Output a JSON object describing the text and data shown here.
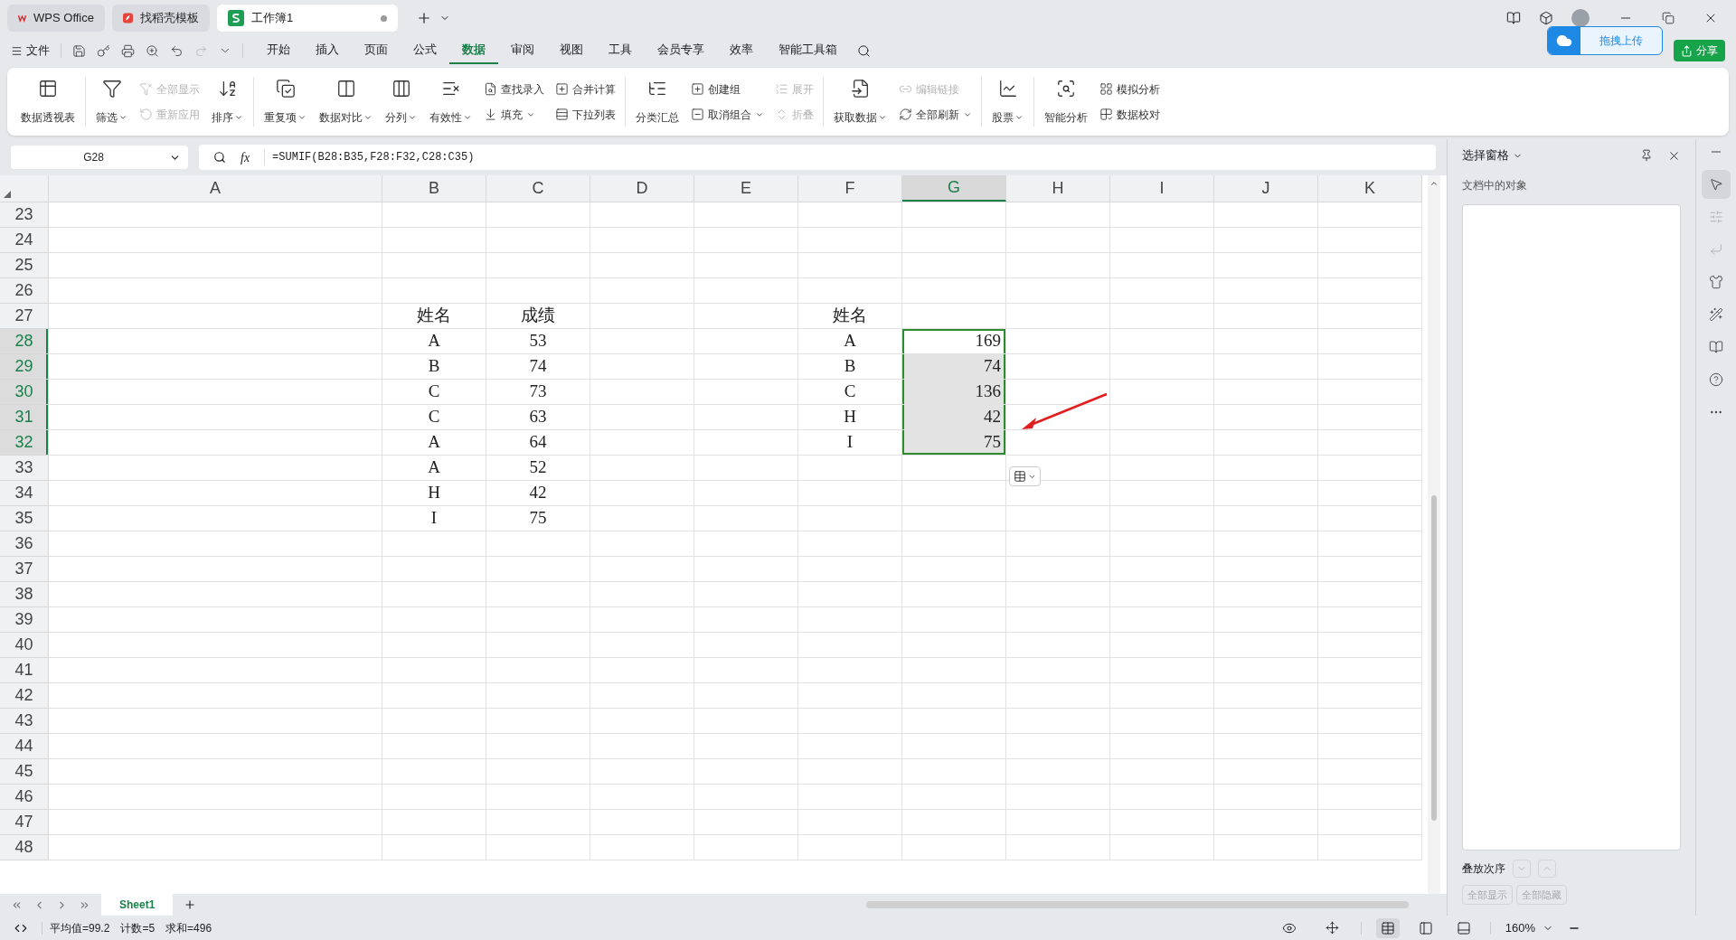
{
  "tabs": [
    {
      "label": "WPS Office",
      "kind": "home",
      "selected": false
    },
    {
      "label": "找稻壳模板",
      "kind": "docer",
      "selected": false
    },
    {
      "label": "工作簿1",
      "kind": "sheet",
      "selected": true,
      "modified": true
    }
  ],
  "menu": {
    "file": "文件",
    "tabs": [
      {
        "label": "开始",
        "selected": false
      },
      {
        "label": "插入",
        "selected": false
      },
      {
        "label": "页面",
        "selected": false
      },
      {
        "label": "公式",
        "selected": false
      },
      {
        "label": "数据",
        "selected": true
      },
      {
        "label": "审阅",
        "selected": false
      },
      {
        "label": "视图",
        "selected": false
      },
      {
        "label": "工具",
        "selected": false
      },
      {
        "label": "会员专享",
        "selected": false
      },
      {
        "label": "效率",
        "selected": false
      },
      {
        "label": "智能工具箱",
        "selected": false
      }
    ]
  },
  "upload_button": "拖拽上传",
  "share_button": "分享",
  "ribbon": [
    {
      "items": [
        {
          "kind": "large",
          "label": "数据透视表",
          "dropdown": false
        }
      ]
    },
    {
      "items": [
        {
          "kind": "large",
          "label": "筛选",
          "dropdown": true
        },
        {
          "kind": "stack",
          "items": [
            {
              "label": "全部显示",
              "disabled": true,
              "dropdown": false
            },
            {
              "label": "重新应用",
              "disabled": true,
              "dropdown": false
            }
          ]
        },
        {
          "kind": "large",
          "label": "排序",
          "dropdown": true
        }
      ]
    },
    {
      "items": [
        {
          "kind": "large",
          "label": "重复项",
          "dropdown": true
        },
        {
          "kind": "large",
          "label": "数据对比",
          "dropdown": true
        },
        {
          "kind": "large",
          "label": "分列",
          "dropdown": true
        },
        {
          "kind": "large",
          "label": "有效性",
          "dropdown": true
        },
        {
          "kind": "stack",
          "items": [
            {
              "label": "查找录入",
              "disabled": false,
              "dropdown": false
            },
            {
              "label": "填充",
              "disabled": false,
              "dropdown": true
            }
          ]
        },
        {
          "kind": "stack",
          "items": [
            {
              "label": "合并计算",
              "disabled": false,
              "dropdown": false
            },
            {
              "label": "下拉列表",
              "disabled": false,
              "dropdown": false
            }
          ]
        }
      ]
    },
    {
      "items": [
        {
          "kind": "large",
          "label": "分类汇总",
          "dropdown": false
        },
        {
          "kind": "stack",
          "items": [
            {
              "label": "创建组",
              "disabled": false,
              "dropdown": false
            },
            {
              "label": "取消组合",
              "disabled": false,
              "dropdown": true
            }
          ]
        },
        {
          "kind": "stack",
          "items": [
            {
              "label": "展开",
              "disabled": true,
              "dropdown": false
            },
            {
              "label": "折叠",
              "disabled": true,
              "dropdown": false
            }
          ]
        }
      ]
    },
    {
      "items": [
        {
          "kind": "large",
          "label": "获取数据",
          "dropdown": true
        },
        {
          "kind": "stack",
          "items": [
            {
              "label": "编辑链接",
              "disabled": true,
              "dropdown": false
            },
            {
              "label": "全部刷新",
              "disabled": false,
              "dropdown": true
            }
          ]
        }
      ]
    },
    {
      "items": [
        {
          "kind": "large",
          "label": "股票",
          "dropdown": true
        }
      ]
    },
    {
      "items": [
        {
          "kind": "large",
          "label": "智能分析",
          "dropdown": false
        },
        {
          "kind": "stack",
          "items": [
            {
              "label": "模拟分析",
              "disabled": false,
              "dropdown": false
            },
            {
              "label": "数据校对",
              "disabled": false,
              "dropdown": false
            }
          ]
        }
      ]
    }
  ],
  "name_box": "G28",
  "function_label": "fx",
  "formula": "=SUMIF(B28:B35,F28:F32,C28:C35)",
  "columns": [
    {
      "label": "A",
      "selected": false
    },
    {
      "label": "B",
      "selected": false
    },
    {
      "label": "C",
      "selected": false
    },
    {
      "label": "D",
      "selected": false
    },
    {
      "label": "E",
      "selected": false
    },
    {
      "label": "F",
      "selected": false
    },
    {
      "label": "G",
      "selected": true
    },
    {
      "label": "H",
      "selected": false
    },
    {
      "label": "I",
      "selected": false
    },
    {
      "label": "J",
      "selected": false
    },
    {
      "label": "K",
      "selected": false
    }
  ],
  "rows": [
    {
      "label": "23",
      "selected": false
    },
    {
      "label": "24",
      "selected": false
    },
    {
      "label": "25",
      "selected": false
    },
    {
      "label": "26",
      "selected": false
    },
    {
      "label": "27",
      "selected": false
    },
    {
      "label": "28",
      "selected": true
    },
    {
      "label": "29",
      "selected": true
    },
    {
      "label": "30",
      "selected": true
    },
    {
      "label": "31",
      "selected": true
    },
    {
      "label": "32",
      "selected": true
    },
    {
      "label": "33",
      "selected": false
    },
    {
      "label": "34",
      "selected": false
    },
    {
      "label": "35",
      "selected": false
    },
    {
      "label": "36",
      "selected": false
    },
    {
      "label": "37",
      "selected": false
    },
    {
      "label": "38",
      "selected": false
    },
    {
      "label": "39",
      "selected": false
    },
    {
      "label": "40",
      "selected": false
    },
    {
      "label": "41",
      "selected": false
    },
    {
      "label": "42",
      "selected": false
    },
    {
      "label": "43",
      "selected": false
    },
    {
      "label": "44",
      "selected": false
    },
    {
      "label": "45",
      "selected": false
    },
    {
      "label": "46",
      "selected": false
    },
    {
      "label": "47",
      "selected": false
    },
    {
      "label": "48",
      "selected": false
    }
  ],
  "scores_table": {
    "header": [
      "姓名",
      "成绩"
    ],
    "rows": [
      [
        "A",
        "53"
      ],
      [
        "B",
        "74"
      ],
      [
        "C",
        "73"
      ],
      [
        "C",
        "63"
      ],
      [
        "A",
        "64"
      ],
      [
        "A",
        "52"
      ],
      [
        "H",
        "42"
      ],
      [
        "I",
        "75"
      ]
    ]
  },
  "sum_table": {
    "header": "姓名",
    "rows": [
      {
        "name": "A",
        "sum": "169",
        "selected": true
      },
      {
        "name": "B",
        "sum": "74",
        "selected": true
      },
      {
        "name": "C",
        "sum": "136",
        "selected": true
      },
      {
        "name": "H",
        "sum": "42",
        "selected": true
      },
      {
        "name": "I",
        "sum": "75",
        "selected": true
      }
    ]
  },
  "sheets": [
    {
      "label": "Sheet1",
      "selected": true
    }
  ],
  "status": [
    "平均值=99.2",
    "计数=5",
    "求和=496"
  ],
  "zoom": "160%",
  "views": [
    {
      "kind": "normal",
      "selected": true
    },
    {
      "kind": "split",
      "selected": false
    },
    {
      "kind": "page",
      "selected": false
    }
  ],
  "pane": {
    "title": "选择窗格",
    "section": "文档中的对象",
    "order_label": "叠放次序",
    "buttons": [
      {
        "label": "全部显示",
        "disabled": true
      },
      {
        "label": "全部隐藏",
        "disabled": true
      }
    ]
  }
}
